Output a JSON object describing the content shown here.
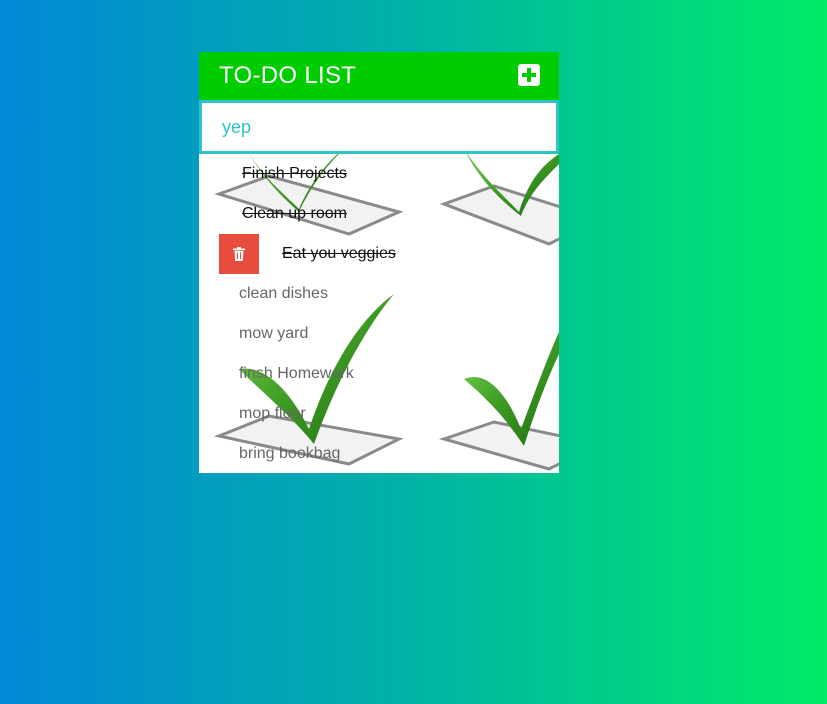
{
  "header": {
    "title": "TO-DO LIST"
  },
  "input": {
    "value": "yep"
  },
  "colors": {
    "header": "#00cd00",
    "input_border": "#2ec2c9",
    "delete": "#e74c3c"
  },
  "todos": [
    {
      "text": "Finish Projects",
      "done": true
    },
    {
      "text": "Clean up room",
      "done": true
    },
    {
      "text": "Eat you veggies",
      "done": true
    },
    {
      "text": "clean dishes",
      "done": false
    },
    {
      "text": "mow yard",
      "done": false
    },
    {
      "text": "finsh Homework",
      "done": false
    },
    {
      "text": "mop floor",
      "done": false
    },
    {
      "text": "bring bookbag",
      "done": false
    }
  ],
  "icons": {
    "add": "plus-square-icon",
    "delete": "trash-icon",
    "background": "checkmark-checkbox-image"
  }
}
